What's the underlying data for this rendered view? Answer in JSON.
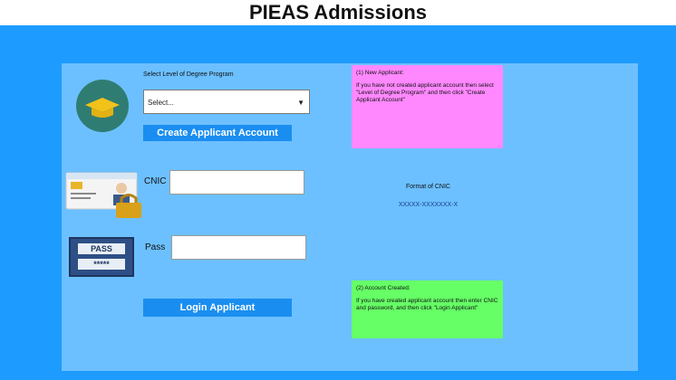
{
  "page": {
    "title": "PIEAS Admissions"
  },
  "degree": {
    "label": "Select Level of Degree Program",
    "selected": "Select..."
  },
  "buttons": {
    "create": "Create Applicant Account",
    "login": "Login Applicant"
  },
  "fields": {
    "cnic_label": "CNIC",
    "pass_label": "Pass"
  },
  "icons": {
    "pass_card_text": "PASS",
    "pass_card_stars": "*****"
  },
  "notes": {
    "new_title": "(1) New Applicant:",
    "new_body": "If you have not created applicant account then select \"Level of Degree Program\" and then click \"Create Applicant Account\"",
    "created_title": "(2) Account Created:",
    "created_body": "If you have created applicant account then enter CNIC and password, and then click \"Login Applicant\""
  },
  "cnic_format": {
    "label": "Format of CNIC",
    "mask": "XXXXX-XXXXXXX-X"
  },
  "colors": {
    "outer_bg": "#1e9bff",
    "panel_bg": "#6cc0ff",
    "button_bg": "#1a8ef0",
    "note_new_bg": "#ff88ff",
    "note_created_bg": "#66ff66"
  }
}
